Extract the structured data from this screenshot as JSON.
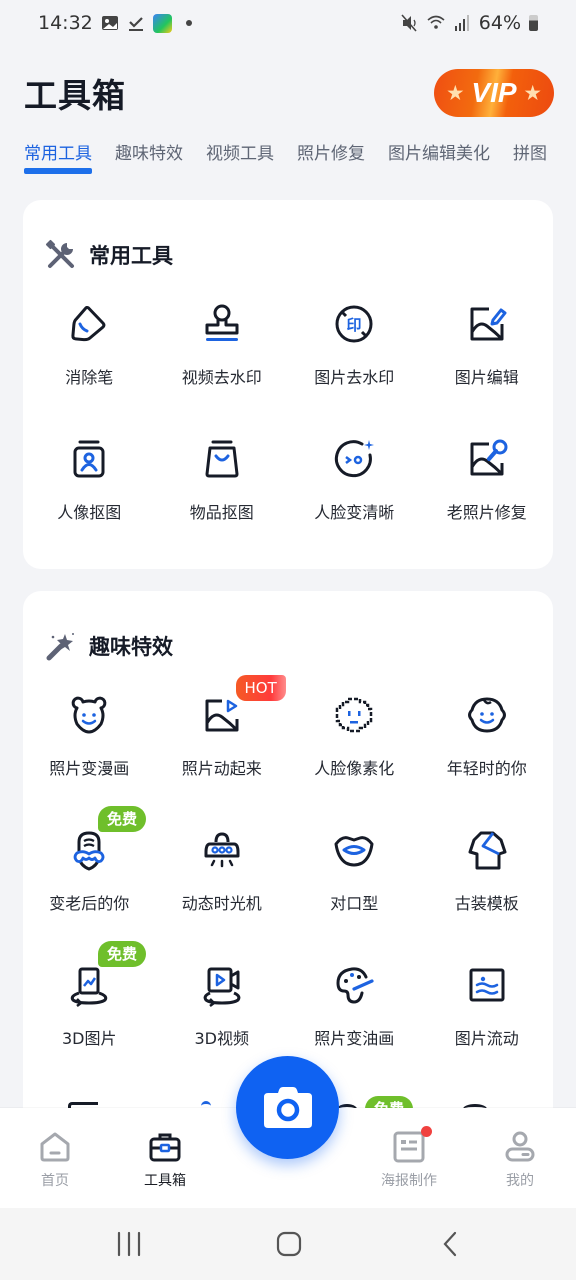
{
  "status_bar": {
    "time": "14:32",
    "battery": "64%",
    "left_icons": [
      "gallery-icon",
      "download-done-icon",
      "cleaner-app-icon",
      "notification-dot"
    ],
    "right_icons": [
      "mute-icon",
      "wifi-icon",
      "signal-icon",
      "battery-icon"
    ]
  },
  "header": {
    "title": "工具箱",
    "vip_label": "VIP"
  },
  "tabs": [
    {
      "label": "常用工具",
      "active": true
    },
    {
      "label": "趣味特效",
      "active": false
    },
    {
      "label": "视频工具",
      "active": false
    },
    {
      "label": "照片修复",
      "active": false
    },
    {
      "label": "图片编辑美化",
      "active": false
    },
    {
      "label": "拼图",
      "active": false
    }
  ],
  "sections": [
    {
      "title": "常用工具",
      "icon": "tools-icon",
      "items": [
        {
          "label": "消除笔",
          "icon": "eraser-icon"
        },
        {
          "label": "视频去水印",
          "icon": "stamp-icon"
        },
        {
          "label": "图片去水印",
          "icon": "no-watermark-icon"
        },
        {
          "label": "图片编辑",
          "icon": "image-edit-icon"
        },
        {
          "label": "人像抠图",
          "icon": "portrait-cutout-icon"
        },
        {
          "label": "物品抠图",
          "icon": "bag-cutout-icon"
        },
        {
          "label": "人脸变清晰",
          "icon": "face-enhance-icon"
        },
        {
          "label": "老照片修复",
          "icon": "photo-repair-icon"
        }
      ]
    },
    {
      "title": "趣味特效",
      "icon": "magic-wand-icon",
      "items": [
        {
          "label": "照片变漫画",
          "icon": "bear-face-icon"
        },
        {
          "label": "照片动起来",
          "icon": "animate-photo-icon",
          "badge": "HOT"
        },
        {
          "label": "人脸像素化",
          "icon": "pixel-face-icon"
        },
        {
          "label": "年轻时的你",
          "icon": "baby-face-icon"
        },
        {
          "label": "变老后的你",
          "icon": "old-face-icon",
          "badge": "免费"
        },
        {
          "label": "动态时光机",
          "icon": "ufo-icon"
        },
        {
          "label": "对口型",
          "icon": "lips-icon"
        },
        {
          "label": "古装模板",
          "icon": "costume-icon"
        },
        {
          "label": "3D图片",
          "icon": "3d-photo-icon",
          "badge": "免费"
        },
        {
          "label": "3D视频",
          "icon": "3d-video-icon"
        },
        {
          "label": "照片变油画",
          "icon": "palette-icon"
        },
        {
          "label": "图片流动",
          "icon": "flow-image-icon"
        }
      ],
      "partial_row_badge": "免费"
    }
  ],
  "bottom_nav": [
    {
      "label": "首页",
      "icon": "home-icon",
      "active": false
    },
    {
      "label": "工具箱",
      "icon": "toolbox-icon",
      "active": true
    },
    {
      "label": "海报制作",
      "icon": "poster-icon",
      "active": false,
      "has_dot": true
    },
    {
      "label": "我的",
      "icon": "profile-icon",
      "active": false
    }
  ],
  "camera_button": {
    "icon": "camera-icon"
  },
  "colors": {
    "accent": "#1d6fea",
    "camera": "#0f62f2",
    "free_badge": "#6fbf2b",
    "hot_badge": "#f55a25",
    "vip": "#f04e12"
  }
}
